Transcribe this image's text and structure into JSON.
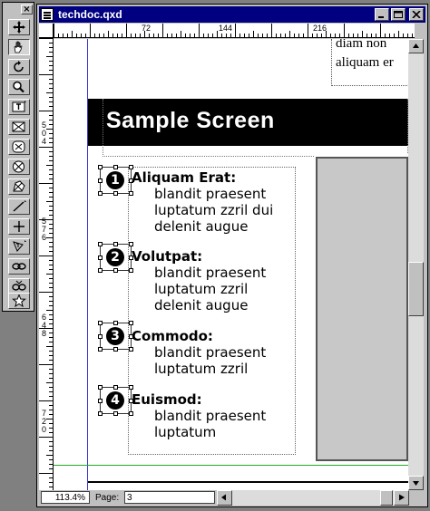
{
  "window": {
    "title": "techdoc.qxd",
    "minimize_label": "_",
    "close_label": "×"
  },
  "palette": {
    "close_label": "×",
    "tools": [
      "move-tool",
      "item-hand-tool",
      "rotate-tool",
      "zoom-tool",
      "text-box-tool",
      "picture-box-tool",
      "oval-picture-tool",
      "rounded-picture-tool",
      "bezier-picture-tool",
      "line-tool",
      "orthogonal-line-tool",
      "text-path-tool",
      "link-tool",
      "unlink-tool",
      "star-tool"
    ]
  },
  "rulers": {
    "h_labels": [
      "72",
      "144",
      "216"
    ],
    "v_labels": [
      "5\n0\n4",
      "5\n7\n6",
      "6\n4\n8",
      "7\n2\n0"
    ]
  },
  "canvas": {
    "top_text": [
      "diam non",
      "aliquam er"
    ],
    "banner": "Sample Screen",
    "items": [
      {
        "num": "1",
        "title": "Aliquam Erat:",
        "lines": [
          "blandit praesent",
          "luptatum zzril dui",
          "delenit augue"
        ]
      },
      {
        "num": "2",
        "title": "Volutpat:",
        "lines": [
          "blandit praesent",
          "luptatum zzril",
          "delenit augue"
        ]
      },
      {
        "num": "3",
        "title": "Commodo:",
        "lines": [
          "blandit praesent",
          "luptatum zzril"
        ]
      },
      {
        "num": "4",
        "title": "Euismod:",
        "lines": [
          "blandit praesent",
          "luptatum"
        ]
      }
    ]
  },
  "status": {
    "zoom": "113.4%",
    "page_label": "Page:",
    "page_value": "3"
  }
}
